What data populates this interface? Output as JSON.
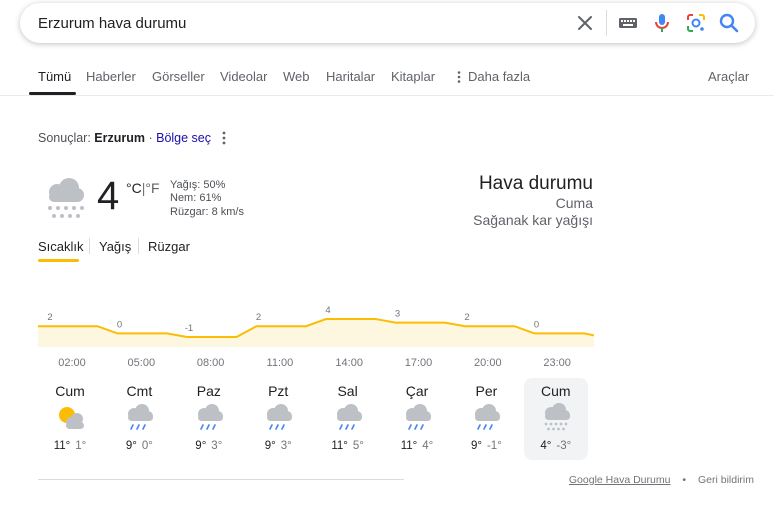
{
  "search": {
    "query": "Erzurum hava durumu"
  },
  "tabs": [
    {
      "label": "Tümü"
    },
    {
      "label": "Haberler"
    },
    {
      "label": "Görseller"
    },
    {
      "label": "Videolar"
    },
    {
      "label": "Web"
    },
    {
      "label": "Haritalar"
    },
    {
      "label": "Kitaplar"
    },
    {
      "label": "Daha fazla"
    }
  ],
  "tools_label": "Araçlar",
  "results": {
    "prefix": "Sonuçlar:",
    "location": "Erzurum",
    "separator": " · ",
    "region_link": "Bölge seç"
  },
  "weather": {
    "temp": "4",
    "unit_c": "°C",
    "unit_sep": "|",
    "unit_f": "°F",
    "precip": "Yağış: 50%",
    "humidity": "Nem: 61%",
    "wind": "Rüzgar: 8 km/s",
    "title": "Hava durumu",
    "day": "Cuma",
    "condition": "Sağanak kar yağışı",
    "tabs": [
      "Sıcaklık",
      "Yağış",
      "Rüzgar"
    ]
  },
  "chart_data": {
    "type": "area",
    "x": [
      "02:00",
      "05:00",
      "08:00",
      "11:00",
      "14:00",
      "17:00",
      "20:00",
      "23:00"
    ],
    "values": [
      2,
      0,
      -1,
      2,
      4,
      3,
      2,
      0
    ],
    "color": "#fbbc04",
    "fill": "#fef7e0"
  },
  "forecast": [
    {
      "day": "Cum",
      "high": "11°",
      "low": "1°",
      "icon": "partly-cloudy-icon"
    },
    {
      "day": "Cmt",
      "high": "9°",
      "low": "0°",
      "icon": "rain-icon"
    },
    {
      "day": "Paz",
      "high": "9°",
      "low": "3°",
      "icon": "rain-icon"
    },
    {
      "day": "Pzt",
      "high": "9°",
      "low": "3°",
      "icon": "rain-icon"
    },
    {
      "day": "Sal",
      "high": "11°",
      "low": "5°",
      "icon": "rain-icon"
    },
    {
      "day": "Çar",
      "high": "11°",
      "low": "4°",
      "icon": "rain-icon"
    },
    {
      "day": "Per",
      "high": "9°",
      "low": "-1°",
      "icon": "rain-icon"
    },
    {
      "day": "Cum",
      "high": "4°",
      "low": "-3°",
      "icon": "snow-icon"
    }
  ],
  "footer": {
    "source": "Google Hava Durumu",
    "bullet": "•",
    "feedback": "Geri bildirim"
  }
}
